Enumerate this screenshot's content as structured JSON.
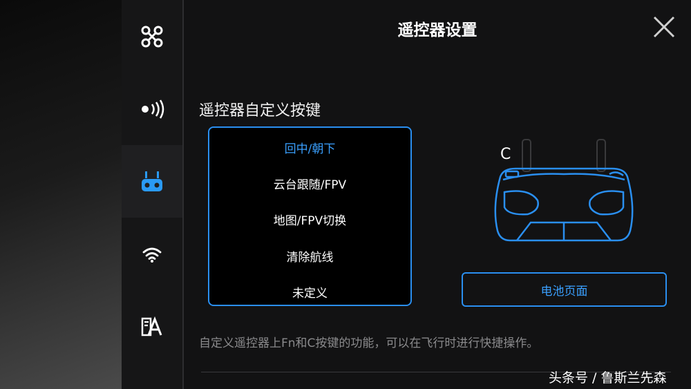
{
  "header": {
    "title": "遥控器设置",
    "close_icon": "close-icon"
  },
  "sidebar": {
    "items": [
      {
        "icon": "drone-icon",
        "active": false
      },
      {
        "icon": "signal-icon",
        "active": false
      },
      {
        "icon": "remote-controller-icon",
        "active": true
      },
      {
        "icon": "wifi-icon",
        "active": false
      },
      {
        "icon": "language-icon",
        "active": false
      }
    ]
  },
  "main": {
    "section_heading": "遥控器自定义按键",
    "key_options": [
      "回中/朝下",
      "云台跟随/FPV",
      "地图/FPV切换",
      "清除航线",
      "未定义"
    ],
    "selected_option": "回中/朝下",
    "controller_label": "C",
    "battery_button": "电池页面",
    "description": "自定义遥控器上Fn和C按键的功能，可以在飞行时进行快捷操作。"
  },
  "watermark": "头条号 / 鲁斯兰先森",
  "colors": {
    "accent": "#2a8ff0",
    "accent_text": "#3aa0ff",
    "background": "#121213"
  }
}
